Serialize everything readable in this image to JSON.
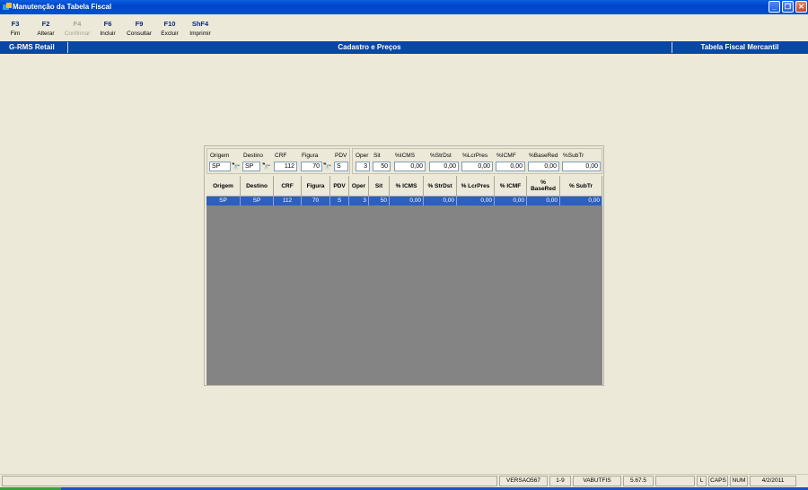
{
  "window": {
    "title": "Manutenção da Tabela Fiscal"
  },
  "toolbar": [
    {
      "key": "F3",
      "label": "Fim",
      "enabled": true
    },
    {
      "key": "F2",
      "label": "Alterar",
      "enabled": true
    },
    {
      "key": "F4",
      "label": "Confirmar",
      "enabled": false
    },
    {
      "key": "F6",
      "label": "Incluir",
      "enabled": true
    },
    {
      "key": "F9",
      "label": "Consultar",
      "enabled": true
    },
    {
      "key": "F10",
      "label": "Excluir",
      "enabled": true
    },
    {
      "key": "ShF4",
      "label": "Imprimir",
      "enabled": true
    }
  ],
  "header": {
    "left": "G-RMS Retail",
    "center": "Cadastro e Preços",
    "right": "Tabela Fiscal Mercantil"
  },
  "filters": {
    "labels": {
      "origem": "Origem",
      "destino": "Destino",
      "crf": "CRF",
      "figura": "Figura",
      "pdv": "PDV",
      "oper": "Oper",
      "sit": "Sit",
      "icms": "%ICMS",
      "strdst": "%StrDst",
      "lcrpres": "%LcrPres",
      "icmf": "%ICMF",
      "basered": "%BaseRed",
      "subtr": "%SubTr"
    },
    "values": {
      "origem": "SP",
      "destino": "SP",
      "crf": "112",
      "figura": "70",
      "pdv": "S",
      "oper": "3",
      "sit": "50",
      "icms": "0,00",
      "strdst": "0,00",
      "lcrpres": "0,00",
      "icmf": "0,00",
      "basered": "0,00",
      "subtr": "0,00"
    }
  },
  "table": {
    "columns": [
      "Origem",
      "Destino",
      "CRF",
      "Figura",
      "PDV",
      "Oper",
      "Sit",
      "% ICMS",
      "% StrDst",
      "% LcrPres",
      "% ICMF",
      "% BaseRed",
      "% SubTr"
    ],
    "rows": [
      [
        "SP",
        "SP",
        "112",
        "70",
        "S",
        "3",
        "50",
        "0,00",
        "0,00",
        "0,00",
        "0,00",
        "0,00",
        "0,00"
      ]
    ]
  },
  "statusbar": {
    "version": "VERSAO567",
    "range": "1-9",
    "module": "VABUTFIS",
    "build": "5.67.5",
    "lock": "L",
    "caps": "CAPS",
    "num": "NUM",
    "date": "4/2/2011"
  }
}
